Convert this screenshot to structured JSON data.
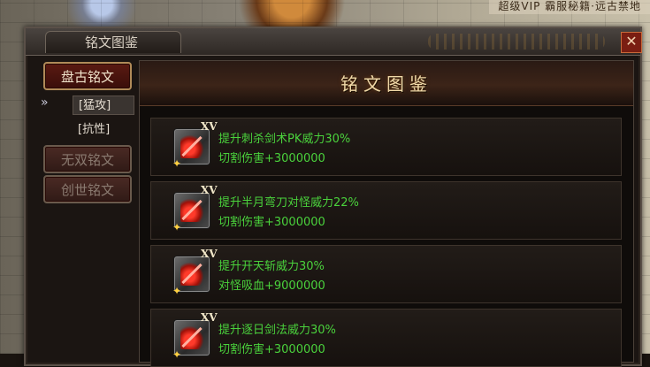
{
  "banner": {
    "text": "超级VIP  霸服秘籍·远古禁地"
  },
  "window": {
    "title": "铭文图鉴",
    "close_label": "✕"
  },
  "sidebar": {
    "buttons": [
      {
        "label": "盘古铭文",
        "state": "active"
      },
      {
        "label": "无双铭文",
        "state": "disabled"
      },
      {
        "label": "创世铭文",
        "state": "disabled"
      }
    ],
    "sub_items": [
      {
        "label": "[猛攻]",
        "selected": true
      },
      {
        "label": "[抗性]",
        "selected": false
      }
    ],
    "chevron": "»"
  },
  "content": {
    "header_title": "铭文图鉴",
    "entries": [
      {
        "level": "XV",
        "icon": "sword-slash-icon",
        "line1": "提升刺杀剑术PK威力30%",
        "line2": "切割伤害+3000000"
      },
      {
        "level": "XV",
        "icon": "curved-blade-icon",
        "line1": "提升半月弯刀对怪威力22%",
        "line2": "切割伤害+3000000"
      },
      {
        "level": "XV",
        "icon": "heaven-split-icon",
        "line1": "提升开天斩威力30%",
        "line2": "对怪吸血+9000000"
      },
      {
        "level": "XV",
        "icon": "sun-chase-sword-icon",
        "line1": "提升逐日剑法威力30%",
        "line2": "切割伤害+3000000"
      }
    ]
  },
  "colors": {
    "effect_text": "#4ad23c",
    "header_gold": "#f0d9a8",
    "button_red": "#5a1a12"
  }
}
